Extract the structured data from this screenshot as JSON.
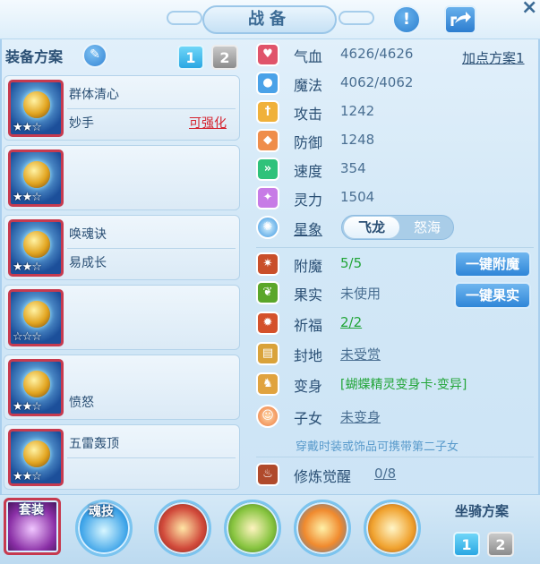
{
  "window": {
    "title": "战备",
    "help_glyph": "!",
    "close_glyph": "×"
  },
  "left": {
    "plan_title": "装备方案",
    "plan_buttons": [
      "1",
      "2"
    ],
    "active_plan": "1",
    "equipment": [
      {
        "name": "群体清心",
        "sub": "妙手",
        "enhance": "可强化",
        "stars": "★★☆"
      },
      {
        "name": "",
        "sub": "",
        "enhance": "",
        "stars": "★★☆"
      },
      {
        "name": "唤魂诀",
        "sub": "易成长",
        "enhance": "",
        "stars": "★★☆"
      },
      {
        "name": "",
        "sub": "",
        "enhance": "",
        "stars": "☆☆☆"
      },
      {
        "name": "",
        "sub": "愤怒",
        "enhance": "",
        "stars": "★★☆"
      },
      {
        "name": "五雷轰顶",
        "sub": "",
        "enhance": "",
        "stars": "★★☆"
      }
    ]
  },
  "stats": {
    "scheme_link": "加点方案1",
    "rows": [
      {
        "label": "气血",
        "value": "4626/4626",
        "icon": "heart-icon",
        "color": "#e0546a"
      },
      {
        "label": "魔法",
        "value": "4062/4062",
        "icon": "mana-icon",
        "color": "#4aa2e8"
      },
      {
        "label": "攻击",
        "value": "1242",
        "icon": "sword-icon",
        "color": "#f0b13a"
      },
      {
        "label": "防御",
        "value": "1248",
        "icon": "shield-icon",
        "color": "#ef8d4a"
      },
      {
        "label": "速度",
        "value": "354",
        "icon": "speed-icon",
        "color": "#2fc27a"
      },
      {
        "label": "灵力",
        "value": "1504",
        "icon": "spirit-icon",
        "color": "#c77be6"
      }
    ],
    "star_sign": {
      "label": "星象",
      "options": [
        "飞龙",
        "怒海"
      ],
      "selected": "飞龙"
    }
  },
  "extras": {
    "enchant": {
      "label": "附魔",
      "value": "5/5",
      "button": "一键附魔"
    },
    "fruit": {
      "label": "果实",
      "value": "未使用",
      "button": "一键果实"
    },
    "blessing": {
      "label": "祈福",
      "value": "2/2"
    },
    "fief": {
      "label": "封地",
      "value": "未受赏"
    },
    "transform": {
      "label": "变身",
      "value": "[蝴蝶精灵变身卡·变异]"
    },
    "child": {
      "label": "子女",
      "value": "未变身"
    },
    "hint": "穿戴时装或饰品可携带第二子女",
    "cultivation": {
      "label": "修炼觉醒",
      "value": "0/8"
    }
  },
  "bottom": {
    "suit_tag": "套装",
    "soul_tag": "魂技",
    "mount_title": "坐骑方案",
    "mount_buttons": [
      "1",
      "2"
    ],
    "active_mount": "1"
  },
  "colors": {
    "accent_blue": "#2f86d8",
    "text_primary": "#2a4f74",
    "enhance_red": "#d5232f",
    "value_green": "#22a538"
  }
}
